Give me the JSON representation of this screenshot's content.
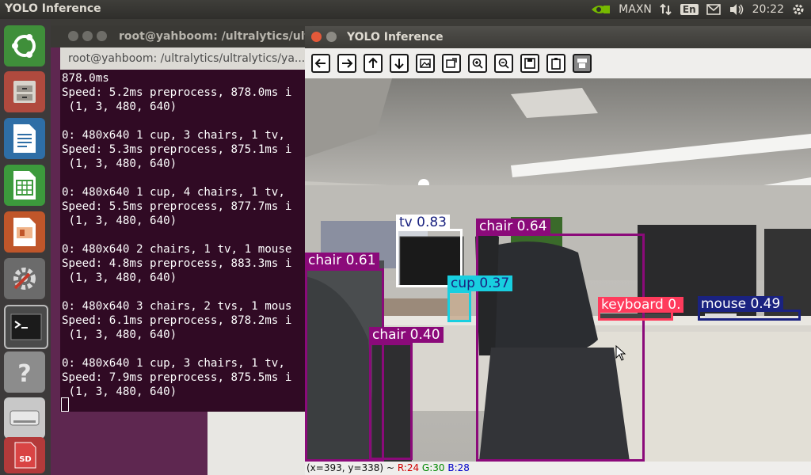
{
  "top_panel": {
    "app_name": "YOLO Inference",
    "power_mode": "MAXN",
    "keyboard_layout": "En",
    "clock": "20:22"
  },
  "launcher": {
    "items": [
      "ubuntu-dash-icon",
      "files-icon",
      "writer-icon",
      "calc-icon",
      "impress-icon",
      "system-settings-icon",
      "terminal-icon",
      "help-icon",
      "disk-icon",
      "sd-card-icon"
    ],
    "sd_label": "SD"
  },
  "background_window": {
    "title": "root@yahboom: /ultralytics/ultralytics"
  },
  "terminal": {
    "title": "root@yahboom: /ultralytics/ultralytics/ya...",
    "lines": [
      "878.0ms",
      "Speed: 5.2ms preprocess, 878.0ms i",
      " (1, 3, 480, 640)",
      "",
      "0: 480x640 1 cup, 3 chairs, 1 tv,",
      "Speed: 5.3ms preprocess, 875.1ms i",
      " (1, 3, 480, 640)",
      "",
      "0: 480x640 1 cup, 4 chairs, 1 tv,",
      "Speed: 5.5ms preprocess, 877.7ms i",
      " (1, 3, 480, 640)",
      "",
      "0: 480x640 2 chairs, 1 tv, 1 mouse",
      "Speed: 4.8ms preprocess, 883.3ms i",
      " (1, 3, 480, 640)",
      "",
      "0: 480x640 3 chairs, 2 tvs, 1 mous",
      "Speed: 6.1ms preprocess, 878.2ms i",
      " (1, 3, 480, 640)",
      "",
      "0: 480x640 1 cup, 3 chairs, 1 tv,",
      "Speed: 7.9ms preprocess, 875.5ms i",
      " (1, 3, 480, 640)"
    ]
  },
  "yolo_window": {
    "title": "YOLO Inference",
    "toolbar": [
      "back-icon",
      "forward-icon",
      "pan-up-icon",
      "pan-down-icon",
      "image-icon",
      "image-edit-icon",
      "zoom-in-icon",
      "zoom-out-icon",
      "save-icon",
      "clipboard-icon",
      "properties-icon"
    ],
    "detections": [
      {
        "label": "tv 0.83",
        "color": "#ffffff"
      },
      {
        "label": "chair 0.64",
        "color": "#8b0a7a"
      },
      {
        "label": "chair 0.61",
        "color": "#8b0a7a"
      },
      {
        "label": "cup 0.37",
        "color": "#18cfe0"
      },
      {
        "label": "keyboard 0.",
        "color": "#ff3b5c"
      },
      {
        "label": "mouse 0.49",
        "color": "#1a2280"
      },
      {
        "label": "chair 0.40",
        "color": "#8b0a7a"
      }
    ],
    "status": {
      "coords": "(x=393, y=338) ~",
      "r": "R:24",
      "g": "G:30",
      "b": "B:28"
    }
  }
}
